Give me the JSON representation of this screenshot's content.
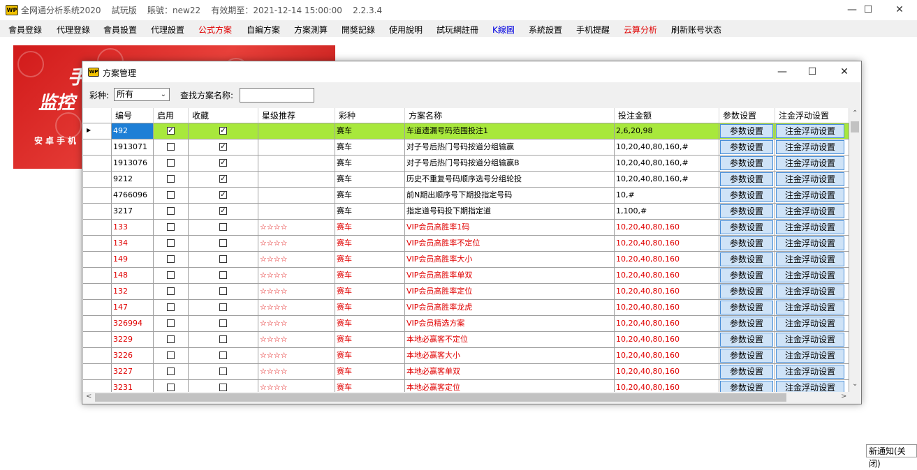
{
  "window": {
    "title": "全网通分析系统2020    試玩版    賬號：new22    有效期至：2021-12-14 15:00:00    2.2.3.4",
    "icon_label": "WP",
    "controls": {
      "minimize": "—",
      "maximize": "☐",
      "close": "✕"
    }
  },
  "menu": [
    {
      "label": "會員登錄",
      "color": "#000000"
    },
    {
      "label": "代理登錄",
      "color": "#000000"
    },
    {
      "label": "會員設置",
      "color": "#000000"
    },
    {
      "label": "代理設置",
      "color": "#000000"
    },
    {
      "label": "公式方案",
      "color": "#e00000"
    },
    {
      "label": "自編方案",
      "color": "#000000"
    },
    {
      "label": "方案測算",
      "color": "#000000"
    },
    {
      "label": "開獎記錄",
      "color": "#000000"
    },
    {
      "label": "使用說明",
      "color": "#000000"
    },
    {
      "label": "試玩網註冊",
      "color": "#000000"
    },
    {
      "label": "K線圖",
      "color": "#0000e0"
    },
    {
      "label": "系統設置",
      "color": "#000000"
    },
    {
      "label": "手机提醒",
      "color": "#000000"
    },
    {
      "label": "云算分析",
      "color": "#e00000"
    },
    {
      "label": "刷新账号状态",
      "color": "#000000"
    }
  ],
  "banner": {
    "line1": "手",
    "line2": "监控",
    "line3": "安卓手机"
  },
  "dialog": {
    "title": "方案管理",
    "icon_label": "WP",
    "controls": {
      "minimize": "—",
      "maximize": "☐",
      "close": "✕"
    },
    "filter": {
      "lottery_label": "彩种:",
      "lottery_value": "所有",
      "search_label": "查找方案名称:",
      "search_value": ""
    },
    "columns": [
      "编号",
      "启用",
      "收藏",
      "星级推荐",
      "彩种",
      "方案名称",
      "投注金额",
      "参数设置",
      "注金浮动设置"
    ],
    "button_labels": {
      "params": "参数设置",
      "float": "注金浮动设置"
    },
    "rows": [
      {
        "id": "492",
        "enabled": true,
        "favorite": true,
        "stars": "",
        "lottery": "赛车",
        "name": "车道遗漏号码范围投注1",
        "amount": "2,6,20,98",
        "red": false,
        "selected": true
      },
      {
        "id": "1913071",
        "enabled": false,
        "favorite": true,
        "stars": "",
        "lottery": "赛车",
        "name": "对子号后热门号码按道分组输赢",
        "amount": "10,20,40,80,160,#",
        "red": false
      },
      {
        "id": "1913076",
        "enabled": false,
        "favorite": true,
        "stars": "",
        "lottery": "赛车",
        "name": "对子号后热门号码按道分组输赢B",
        "amount": "10,20,40,80,160,#",
        "red": false
      },
      {
        "id": "9212",
        "enabled": false,
        "favorite": true,
        "stars": "",
        "lottery": "赛车",
        "name": "历史不重复号码顺序选号分组轮投",
        "amount": "10,20,40,80,160,#",
        "red": false
      },
      {
        "id": "4766096",
        "enabled": false,
        "favorite": true,
        "stars": "",
        "lottery": "赛车",
        "name": "前N期出顺序号下期投指定号码",
        "amount": "10,#",
        "red": false
      },
      {
        "id": "3217",
        "enabled": false,
        "favorite": true,
        "stars": "",
        "lottery": "赛车",
        "name": "指定道号码投下期指定道",
        "amount": "1,100,#",
        "red": false
      },
      {
        "id": "133",
        "enabled": false,
        "favorite": false,
        "stars": "☆☆☆☆",
        "lottery": "赛车",
        "name": "VIP会员高胜率1码",
        "amount": "10,20,40,80,160",
        "red": true
      },
      {
        "id": "134",
        "enabled": false,
        "favorite": false,
        "stars": "☆☆☆☆",
        "lottery": "赛车",
        "name": "VIP会员高胜率不定位",
        "amount": "10,20,40,80,160",
        "red": true
      },
      {
        "id": "149",
        "enabled": false,
        "favorite": false,
        "stars": "☆☆☆☆",
        "lottery": "赛车",
        "name": "VIP会员高胜率大小",
        "amount": "10,20,40,80,160",
        "red": true
      },
      {
        "id": "148",
        "enabled": false,
        "favorite": false,
        "stars": "☆☆☆☆",
        "lottery": "赛车",
        "name": "VIP会员高胜率单双",
        "amount": "10,20,40,80,160",
        "red": true
      },
      {
        "id": "132",
        "enabled": false,
        "favorite": false,
        "stars": "☆☆☆☆",
        "lottery": "赛车",
        "name": "VIP会员高胜率定位",
        "amount": "10,20,40,80,160",
        "red": true
      },
      {
        "id": "147",
        "enabled": false,
        "favorite": false,
        "stars": "☆☆☆☆",
        "lottery": "赛车",
        "name": "VIP会员高胜率龙虎",
        "amount": "10,20,40,80,160",
        "red": true
      },
      {
        "id": "326994",
        "enabled": false,
        "favorite": false,
        "stars": "☆☆☆☆",
        "lottery": "赛车",
        "name": "VIP会员精选方案",
        "amount": "10,20,40,80,160",
        "red": true
      },
      {
        "id": "3229",
        "enabled": false,
        "favorite": false,
        "stars": "☆☆☆☆",
        "lottery": "赛车",
        "name": "本地必赢客不定位",
        "amount": "10,20,40,80,160",
        "red": true
      },
      {
        "id": "3226",
        "enabled": false,
        "favorite": false,
        "stars": "☆☆☆☆",
        "lottery": "赛车",
        "name": "本地必赢客大小",
        "amount": "10,20,40,80,160",
        "red": true
      },
      {
        "id": "3227",
        "enabled": false,
        "favorite": false,
        "stars": "☆☆☆☆",
        "lottery": "赛车",
        "name": "本地必赢客单双",
        "amount": "10,20,40,80,160",
        "red": true
      },
      {
        "id": "3231",
        "enabled": false,
        "favorite": false,
        "stars": "☆☆☆☆",
        "lottery": "赛车",
        "name": "本地必赢客定位",
        "amount": "10,20,40,80,160",
        "red": true
      }
    ],
    "colors": {
      "selected_row": "#a8e83c",
      "selected_id": "#1e7fd6",
      "red_text": "#e00000",
      "button_bg": "#cfe3f7"
    }
  },
  "notification": {
    "label": "新通知(关闭)"
  }
}
